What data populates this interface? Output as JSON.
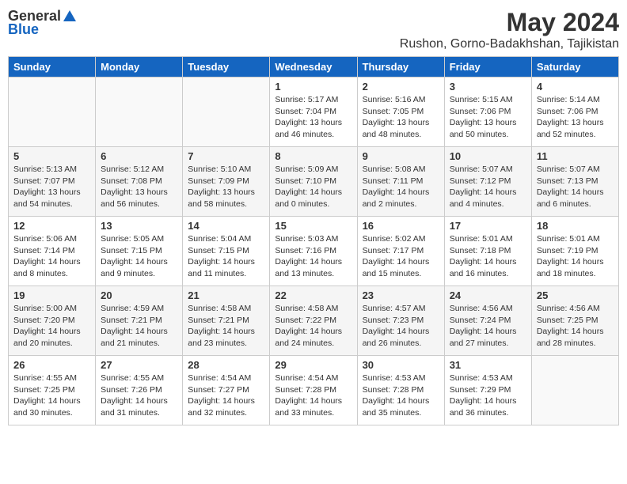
{
  "logo": {
    "general": "General",
    "blue": "Blue"
  },
  "title": "May 2024",
  "location": "Rushon, Gorno-Badakhshan, Tajikistan",
  "days_of_week": [
    "Sunday",
    "Monday",
    "Tuesday",
    "Wednesday",
    "Thursday",
    "Friday",
    "Saturday"
  ],
  "weeks": [
    [
      {
        "day": "",
        "info": ""
      },
      {
        "day": "",
        "info": ""
      },
      {
        "day": "",
        "info": ""
      },
      {
        "day": "1",
        "info": "Sunrise: 5:17 AM\nSunset: 7:04 PM\nDaylight: 13 hours\nand 46 minutes."
      },
      {
        "day": "2",
        "info": "Sunrise: 5:16 AM\nSunset: 7:05 PM\nDaylight: 13 hours\nand 48 minutes."
      },
      {
        "day": "3",
        "info": "Sunrise: 5:15 AM\nSunset: 7:06 PM\nDaylight: 13 hours\nand 50 minutes."
      },
      {
        "day": "4",
        "info": "Sunrise: 5:14 AM\nSunset: 7:06 PM\nDaylight: 13 hours\nand 52 minutes."
      }
    ],
    [
      {
        "day": "5",
        "info": "Sunrise: 5:13 AM\nSunset: 7:07 PM\nDaylight: 13 hours\nand 54 minutes."
      },
      {
        "day": "6",
        "info": "Sunrise: 5:12 AM\nSunset: 7:08 PM\nDaylight: 13 hours\nand 56 minutes."
      },
      {
        "day": "7",
        "info": "Sunrise: 5:10 AM\nSunset: 7:09 PM\nDaylight: 13 hours\nand 58 minutes."
      },
      {
        "day": "8",
        "info": "Sunrise: 5:09 AM\nSunset: 7:10 PM\nDaylight: 14 hours\nand 0 minutes."
      },
      {
        "day": "9",
        "info": "Sunrise: 5:08 AM\nSunset: 7:11 PM\nDaylight: 14 hours\nand 2 minutes."
      },
      {
        "day": "10",
        "info": "Sunrise: 5:07 AM\nSunset: 7:12 PM\nDaylight: 14 hours\nand 4 minutes."
      },
      {
        "day": "11",
        "info": "Sunrise: 5:07 AM\nSunset: 7:13 PM\nDaylight: 14 hours\nand 6 minutes."
      }
    ],
    [
      {
        "day": "12",
        "info": "Sunrise: 5:06 AM\nSunset: 7:14 PM\nDaylight: 14 hours\nand 8 minutes."
      },
      {
        "day": "13",
        "info": "Sunrise: 5:05 AM\nSunset: 7:15 PM\nDaylight: 14 hours\nand 9 minutes."
      },
      {
        "day": "14",
        "info": "Sunrise: 5:04 AM\nSunset: 7:15 PM\nDaylight: 14 hours\nand 11 minutes."
      },
      {
        "day": "15",
        "info": "Sunrise: 5:03 AM\nSunset: 7:16 PM\nDaylight: 14 hours\nand 13 minutes."
      },
      {
        "day": "16",
        "info": "Sunrise: 5:02 AM\nSunset: 7:17 PM\nDaylight: 14 hours\nand 15 minutes."
      },
      {
        "day": "17",
        "info": "Sunrise: 5:01 AM\nSunset: 7:18 PM\nDaylight: 14 hours\nand 16 minutes."
      },
      {
        "day": "18",
        "info": "Sunrise: 5:01 AM\nSunset: 7:19 PM\nDaylight: 14 hours\nand 18 minutes."
      }
    ],
    [
      {
        "day": "19",
        "info": "Sunrise: 5:00 AM\nSunset: 7:20 PM\nDaylight: 14 hours\nand 20 minutes."
      },
      {
        "day": "20",
        "info": "Sunrise: 4:59 AM\nSunset: 7:21 PM\nDaylight: 14 hours\nand 21 minutes."
      },
      {
        "day": "21",
        "info": "Sunrise: 4:58 AM\nSunset: 7:21 PM\nDaylight: 14 hours\nand 23 minutes."
      },
      {
        "day": "22",
        "info": "Sunrise: 4:58 AM\nSunset: 7:22 PM\nDaylight: 14 hours\nand 24 minutes."
      },
      {
        "day": "23",
        "info": "Sunrise: 4:57 AM\nSunset: 7:23 PM\nDaylight: 14 hours\nand 26 minutes."
      },
      {
        "day": "24",
        "info": "Sunrise: 4:56 AM\nSunset: 7:24 PM\nDaylight: 14 hours\nand 27 minutes."
      },
      {
        "day": "25",
        "info": "Sunrise: 4:56 AM\nSunset: 7:25 PM\nDaylight: 14 hours\nand 28 minutes."
      }
    ],
    [
      {
        "day": "26",
        "info": "Sunrise: 4:55 AM\nSunset: 7:25 PM\nDaylight: 14 hours\nand 30 minutes."
      },
      {
        "day": "27",
        "info": "Sunrise: 4:55 AM\nSunset: 7:26 PM\nDaylight: 14 hours\nand 31 minutes."
      },
      {
        "day": "28",
        "info": "Sunrise: 4:54 AM\nSunset: 7:27 PM\nDaylight: 14 hours\nand 32 minutes."
      },
      {
        "day": "29",
        "info": "Sunrise: 4:54 AM\nSunset: 7:28 PM\nDaylight: 14 hours\nand 33 minutes."
      },
      {
        "day": "30",
        "info": "Sunrise: 4:53 AM\nSunset: 7:28 PM\nDaylight: 14 hours\nand 35 minutes."
      },
      {
        "day": "31",
        "info": "Sunrise: 4:53 AM\nSunset: 7:29 PM\nDaylight: 14 hours\nand 36 minutes."
      },
      {
        "day": "",
        "info": ""
      }
    ]
  ]
}
